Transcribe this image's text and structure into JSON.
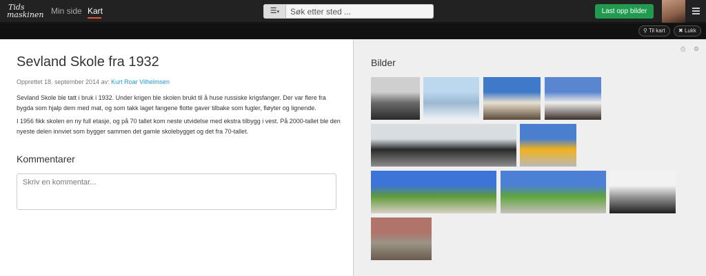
{
  "header": {
    "logo_line1": "Tids",
    "logo_line2": "maskinen",
    "nav": [
      {
        "label": "Min side",
        "active": false
      },
      {
        "label": "Kart",
        "active": true
      }
    ],
    "search_placeholder": "Søk etter sted ...",
    "upload_label": "Last opp bilder"
  },
  "subbar": {
    "to_map_label": "Til kart",
    "close_label": "Lukk"
  },
  "article": {
    "title": "Sevland Skole fra 1932",
    "created_prefix": "Opprettet 18. september 2014 av:",
    "author": "Kurt Roar Vilhelmsen",
    "paragraphs": [
      "Sevland Skole ble tatt i bruk i 1932. Under krigen ble skolen brukt til å huse russiske krigsfanger. Der var flere fra bygda som hjalp dem med mat, og som takk laget fangene flotte gaver tilbake som fugler, fløyter og lignende.",
      "I 1956 fikk skolen en ny full etasje, og på 70 tallet kom neste utvidelse med ekstra tilbygg i vest. På 2000-tallet ble den nyeste delen innviet som bygger sammen det gamle skolebygget og det fra 70-tallet."
    ],
    "comments_heading": "Kommentarer",
    "comment_placeholder": "Skriv en kommentar..."
  },
  "gallery": {
    "heading": "Bilder",
    "photos": [
      {
        "name": "photo-old-class",
        "colors": [
          "#cfcfcf",
          "#6a6a6a",
          "#2a2a2a"
        ]
      },
      {
        "name": "photo-school-snow",
        "colors": [
          "#bcd8ef",
          "#9bb8d0",
          "#eef3f7"
        ]
      },
      {
        "name": "photo-school-building",
        "colors": [
          "#3f79c9",
          "#e8e0cf",
          "#5a4a3a"
        ]
      },
      {
        "name": "photo-crowd-entrance",
        "colors": [
          "#5a86cf",
          "#f0eeea",
          "#3a2e2a"
        ]
      },
      {
        "name": "photo-crowd-panorama",
        "colors": [
          "#d8dde2",
          "#2b2b2b",
          "#8d8d8d"
        ]
      },
      {
        "name": "photo-playground",
        "colors": [
          "#4a7fd0",
          "#f2b21c",
          "#b9b9b9"
        ]
      },
      {
        "name": "photo-yard-panorama",
        "colors": [
          "#3c74d8",
          "#5f9a3a",
          "#d8d0c4"
        ]
      },
      {
        "name": "photo-field-panorama",
        "colors": [
          "#4c80d4",
          "#5ea53b",
          "#c4c0bc"
        ]
      },
      {
        "name": "photo-bw-house",
        "colors": [
          "#f2f2f2",
          "#9a9a9a",
          "#1f1f1f"
        ]
      },
      {
        "name": "photo-aerial",
        "colors": [
          "#b0746a",
          "#9a9586",
          "#6b5a4d"
        ]
      }
    ]
  }
}
